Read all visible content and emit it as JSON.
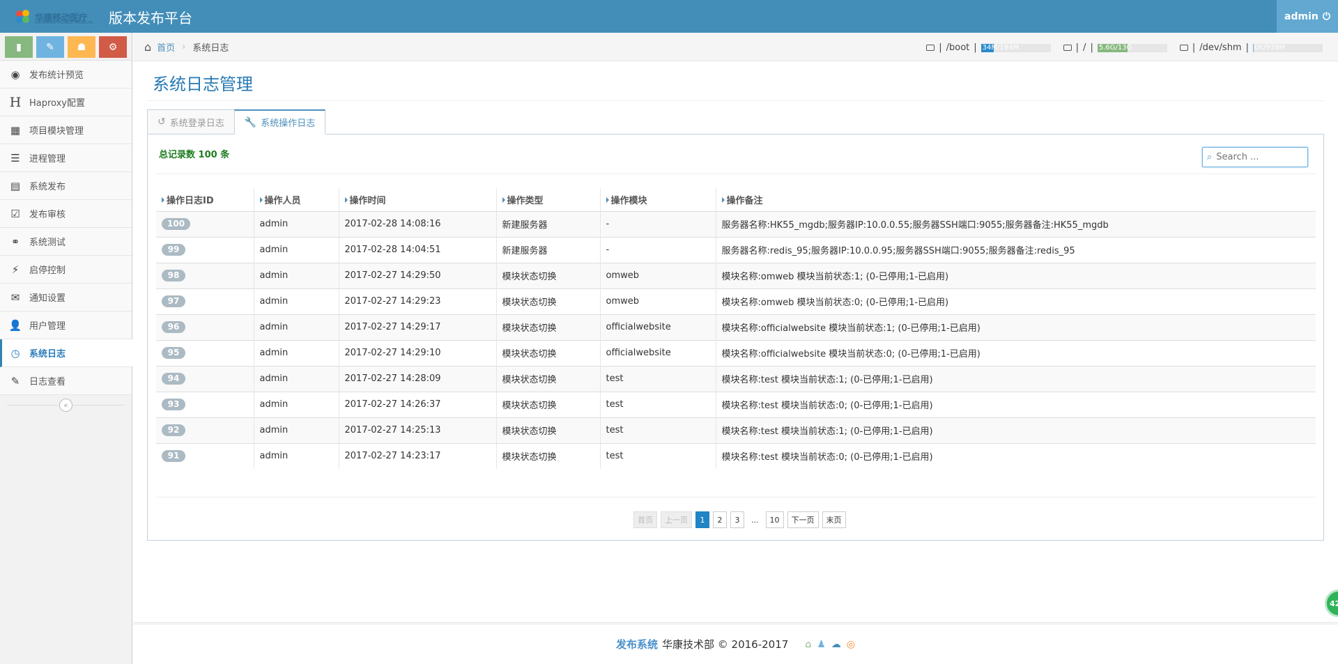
{
  "navbar": {
    "logo_text": "华康移动医疗",
    "logo_sub": "HUAKANG MOBILE MEDICAL",
    "title": "版本发布平台",
    "user": "admin"
  },
  "sidebar": {
    "items": [
      {
        "label": "发布统计预览",
        "icon": "dashboard-icon",
        "glyph": "◉",
        "active": false
      },
      {
        "label": "Haproxy配置",
        "icon": "h-letter-icon",
        "glyph": "H",
        "active": false
      },
      {
        "label": "项目模块管理",
        "icon": "grid-icon",
        "glyph": "▦",
        "active": false
      },
      {
        "label": "进程管理",
        "icon": "server-icon",
        "glyph": "☰",
        "active": false
      },
      {
        "label": "系统发布",
        "icon": "list-icon",
        "glyph": "▤",
        "active": false
      },
      {
        "label": "发布审核",
        "icon": "check-icon",
        "glyph": "☑",
        "active": false
      },
      {
        "label": "系统测试",
        "icon": "link-icon",
        "glyph": "⚭",
        "active": false
      },
      {
        "label": "启停控制",
        "icon": "bolt-icon",
        "glyph": "⚡",
        "active": false
      },
      {
        "label": "通知设置",
        "icon": "envelope-icon",
        "glyph": "✉",
        "active": false
      },
      {
        "label": "用户管理",
        "icon": "user-icon",
        "glyph": "👤",
        "active": false
      },
      {
        "label": "系统日志",
        "icon": "clock-icon",
        "glyph": "◷",
        "active": true
      },
      {
        "label": "日志查看",
        "icon": "edit-icon",
        "glyph": "✎",
        "active": false
      }
    ]
  },
  "breadcrumb": {
    "home": "首页",
    "current": "系统日志"
  },
  "disks": [
    {
      "mount": "/boot",
      "usage": "34M/194M",
      "percent": 18,
      "color": "#2a8bcc"
    },
    {
      "mount": "/",
      "usage": "5.6G/13G",
      "percent": 43,
      "color": "#87b87f"
    },
    {
      "mount": "/dev/shm",
      "usage": "0K/939M",
      "percent": 1,
      "color": "#6fb3e0"
    }
  ],
  "page": {
    "title": "系统日志管理"
  },
  "tabs": [
    {
      "label": "系统登录日志",
      "active": false
    },
    {
      "label": "系统操作日志",
      "active": true
    }
  ],
  "panel": {
    "total": "总记录数 100 条",
    "search_placeholder": "Search ..."
  },
  "table": {
    "headers": [
      "操作日志ID",
      "操作人员",
      "操作时间",
      "操作类型",
      "操作模块",
      "操作备注"
    ],
    "rows": [
      [
        "100",
        "admin",
        "2017-02-28 14:08:16",
        "新建服务器",
        "-",
        "服务器名称:HK55_mgdb;服务器IP:10.0.0.55;服务器SSH端口:9055;服务器备注:HK55_mgdb"
      ],
      [
        "99",
        "admin",
        "2017-02-28 14:04:51",
        "新建服务器",
        "-",
        "服务器名称:redis_95;服务器IP:10.0.0.95;服务器SSH端口:9055;服务器备注:redis_95"
      ],
      [
        "98",
        "admin",
        "2017-02-27 14:29:50",
        "模块状态切换",
        "omweb",
        "模块名称:omweb 模块当前状态:1; (0-已停用;1-已启用)"
      ],
      [
        "97",
        "admin",
        "2017-02-27 14:29:23",
        "模块状态切换",
        "omweb",
        "模块名称:omweb 模块当前状态:0; (0-已停用;1-已启用)"
      ],
      [
        "96",
        "admin",
        "2017-02-27 14:29:17",
        "模块状态切换",
        "officialwebsite",
        "模块名称:officialwebsite 模块当前状态:1; (0-已停用;1-已启用)"
      ],
      [
        "95",
        "admin",
        "2017-02-27 14:29:10",
        "模块状态切换",
        "officialwebsite",
        "模块名称:officialwebsite 模块当前状态:0; (0-已停用;1-已启用)"
      ],
      [
        "94",
        "admin",
        "2017-02-27 14:28:09",
        "模块状态切换",
        "test",
        "模块名称:test 模块当前状态:1; (0-已停用;1-已启用)"
      ],
      [
        "93",
        "admin",
        "2017-02-27 14:26:37",
        "模块状态切换",
        "test",
        "模块名称:test 模块当前状态:0; (0-已停用;1-已启用)"
      ],
      [
        "92",
        "admin",
        "2017-02-27 14:25:13",
        "模块状态切换",
        "test",
        "模块名称:test 模块当前状态:1; (0-已停用;1-已启用)"
      ],
      [
        "91",
        "admin",
        "2017-02-27 14:23:17",
        "模块状态切换",
        "test",
        "模块名称:test 模块当前状态:0; (0-已停用;1-已启用)"
      ]
    ]
  },
  "pagination": {
    "first": "首页",
    "prev": "上一页",
    "pages": [
      "1",
      "2",
      "3"
    ],
    "ellipsis": "...",
    "last_page": "10",
    "next": "下一页",
    "last": "末页",
    "current": "1"
  },
  "footer": {
    "brand": "发布系统",
    "text": "华康技术部 © 2016-2017"
  },
  "float_badge": "42"
}
